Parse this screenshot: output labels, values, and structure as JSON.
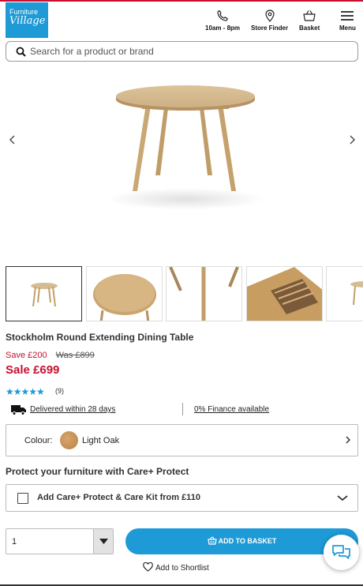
{
  "header": {
    "logo_line1": "Furniture",
    "logo_line2": "Village",
    "hours_label": "10am - 8pm",
    "store_finder_label": "Store Finder",
    "basket_label": "Basket",
    "menu_label": "Menu"
  },
  "search": {
    "placeholder": "Search for a product or brand"
  },
  "product": {
    "title": "Stockholm Round Extending Dining Table",
    "save_text": "Save £200",
    "was_text": "Was £899",
    "sale_text": "Sale £699",
    "rating_stars": "★★★★★",
    "review_count": "(9)"
  },
  "info": {
    "delivery_text": "Delivered within 28 days",
    "finance_text": "0% Finance available"
  },
  "colour": {
    "label": "Colour:",
    "value": "Light Oak",
    "swatch_color": "#c8945a"
  },
  "care": {
    "heading": "Protect your furniture with Care+ Protect",
    "option_label": "Add Care+ Protect & Care Kit from £110"
  },
  "purchase": {
    "quantity": "1",
    "add_to_basket_label": "ADD TO BASKET",
    "shortlist_label": "Add to Shortlist"
  },
  "colors": {
    "brand_blue": "#1e9ad6",
    "sale_red": "#c8102e",
    "oak": "#c8945a"
  },
  "icons": [
    "phone-icon",
    "location-pin-icon",
    "basket-icon",
    "hamburger-menu-icon",
    "search-icon",
    "chevron-left-icon",
    "chevron-right-icon",
    "delivery-truck-icon",
    "chevron-down-icon",
    "heart-icon",
    "chat-icon"
  ]
}
